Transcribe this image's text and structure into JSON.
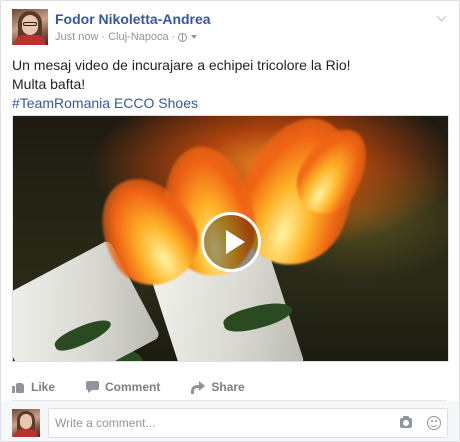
{
  "post": {
    "author": "Fodor Nikoletta-Andrea",
    "timestamp": "Just now",
    "location": "Cluj-Napoca",
    "separator": "·",
    "privacy_icon": "globe-icon",
    "text_lines": [
      "Un mesaj video de incurajare a echipei tricolore la Rio!",
      "Multa bafta!"
    ],
    "hashtag": "#TeamRomania",
    "hashtag_suffix": " ECCO Shoes"
  },
  "video": {
    "play_icon": "play-icon",
    "subject": "olympic-torch-flame"
  },
  "actions": {
    "like_label": "Like",
    "comment_label": "Comment",
    "share_label": "Share"
  },
  "comment_box": {
    "placeholder": "Write a comment...",
    "camera_icon": "camera-icon",
    "emoji_icon": "emoji-icon"
  },
  "colors": {
    "link_blue": "#365899",
    "meta_gray": "#90949c",
    "action_gray": "#7f7f7f",
    "text": "#1d2129",
    "border": "#dddfe2"
  }
}
